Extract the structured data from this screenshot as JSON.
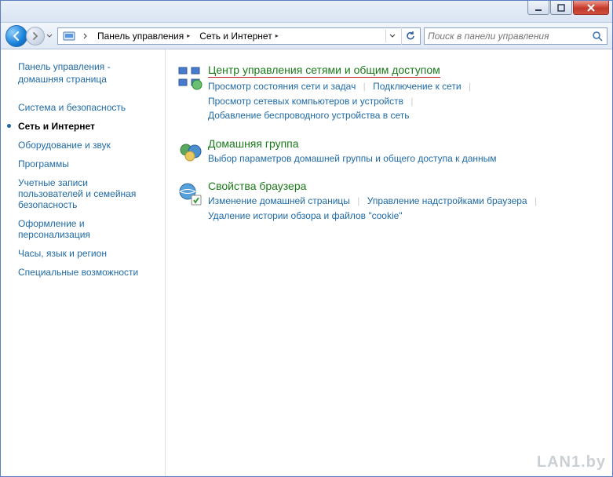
{
  "titlebar": {
    "minimize": "minimize",
    "maximize": "maximize",
    "close": "close"
  },
  "nav": {
    "breadcrumb": [
      {
        "label": "Панель управления"
      },
      {
        "label": "Сеть и Интернет"
      }
    ],
    "search_placeholder": "Поиск в панели управления"
  },
  "sidebar": {
    "home": "Панель управления - домашняя страница",
    "items": [
      {
        "label": "Система и безопасность",
        "active": false
      },
      {
        "label": "Сеть и Интернет",
        "active": true
      },
      {
        "label": "Оборудование и звук",
        "active": false
      },
      {
        "label": "Программы",
        "active": false
      },
      {
        "label": "Учетные записи пользователей и семейная безопасность",
        "active": false
      },
      {
        "label": "Оформление и персонализация",
        "active": false
      },
      {
        "label": "Часы, язык и регион",
        "active": false
      },
      {
        "label": "Специальные возможности",
        "active": false
      }
    ]
  },
  "main": {
    "sections": [
      {
        "title": "Центр управления сетями и общим доступом",
        "highlighted": true,
        "sublinks_row1": [
          "Просмотр состояния сети и задач",
          "Подключение к сети"
        ],
        "sublinks_row2": [
          "Просмотр сетевых компьютеров и устройств"
        ],
        "sublinks_row3": [
          "Добавление беспроводного устройства в сеть"
        ]
      },
      {
        "title": "Домашняя группа",
        "sublinks_row1": [
          "Выбор параметров домашней группы и общего доступа к данным"
        ]
      },
      {
        "title": "Свойства браузера",
        "sublinks_row1": [
          "Изменение домашней страницы",
          "Управление надстройками браузера"
        ],
        "sublinks_row2": [
          "Удаление истории обзора и файлов \"cookie\""
        ]
      }
    ]
  },
  "watermark": "LAN1.by"
}
